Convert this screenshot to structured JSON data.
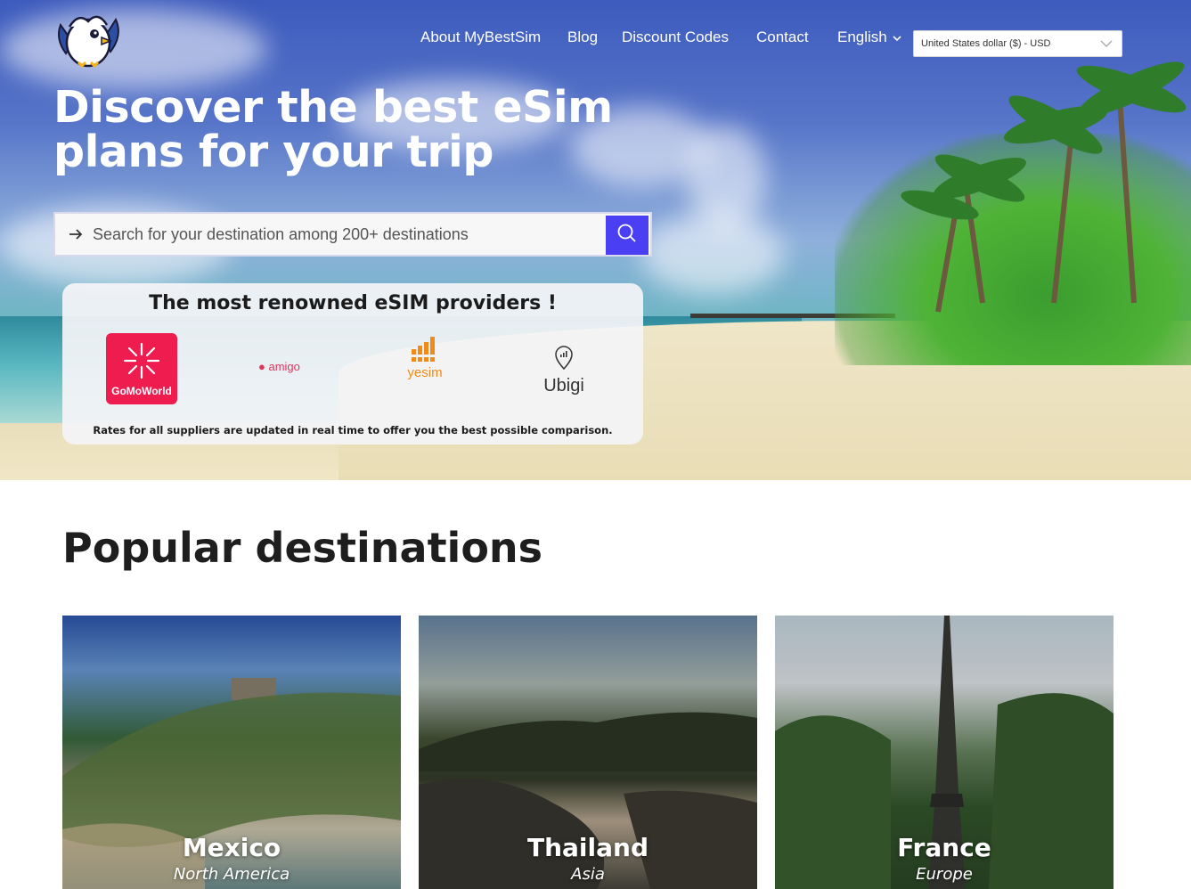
{
  "brand": {
    "logo_icon": "owl-mascot-logo-icon"
  },
  "nav": {
    "items": [
      "About MyBestSim",
      "Blog",
      "Discount Codes",
      "Contact"
    ],
    "language": "English",
    "currency": "United States dollar ($) - USD"
  },
  "hero": {
    "line1_regular": "Discover the best ",
    "line1_bold": "eSim",
    "line2_regular": "plans for your ",
    "line2_bold": "trip"
  },
  "search": {
    "placeholder": "Search for your destination among 200+ destinations",
    "button_icon": "search-icon"
  },
  "providers": {
    "title": "The most renowned eSIM providers !",
    "logos": [
      "GoMoWorld",
      "amigo",
      "yesim",
      "Ubigi"
    ],
    "note": "Rates for all suppliers are updated in real time to offer you the best possible comparison."
  },
  "popular": {
    "title_bold": "Popular",
    "title_regular": " destinations",
    "destinations": [
      {
        "name": "Mexico",
        "region": "North America"
      },
      {
        "name": "Thailand",
        "region": "Asia"
      },
      {
        "name": "France",
        "region": "Europe"
      }
    ]
  },
  "colors": {
    "accent": "#4a3ff2",
    "gomo_red": "#ee1c4f",
    "yesim_orange": "#f08a1b",
    "amigo_pink": "#e0345b"
  }
}
